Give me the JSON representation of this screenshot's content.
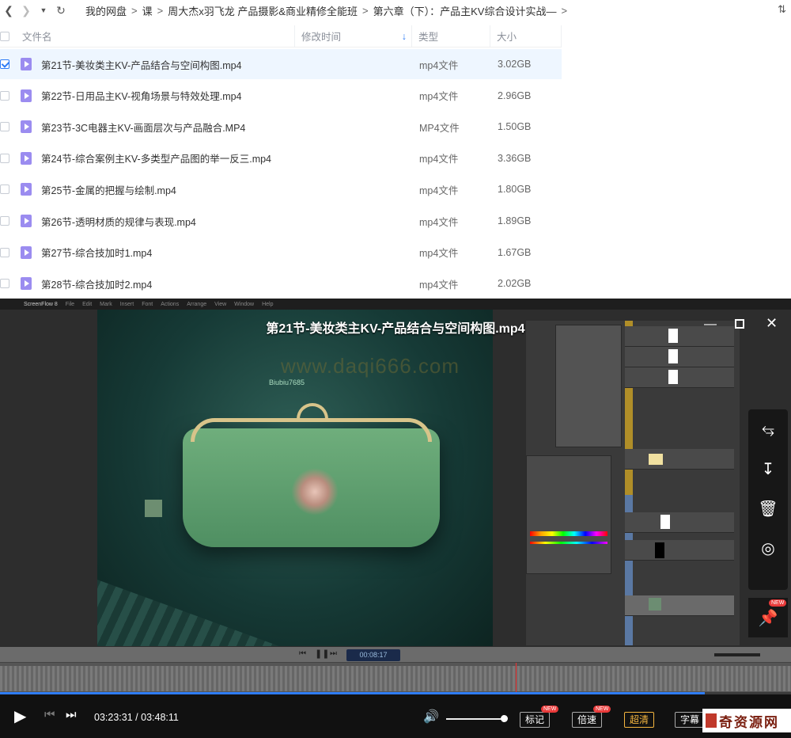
{
  "breadcrumb": [
    "我的网盘",
    "课",
    "周大杰x羽飞龙 产品摄影&商业精修全能班",
    "第六章（下）：产品主KV综合设计实战—"
  ],
  "columns": {
    "name": "文件名",
    "modified": "修改时间",
    "type": "类型",
    "size": "大小"
  },
  "files": [
    {
      "name": "第21节-美妆类主KV-产品结合与空间构图.mp4",
      "type": "mp4文件",
      "size": "3.02GB",
      "selected": true
    },
    {
      "name": "第22节-日用品主KV-视角场景与特效处理.mp4",
      "type": "mp4文件",
      "size": "2.96GB",
      "selected": false
    },
    {
      "name": "第23节-3C电器主KV-画面层次与产品融合.MP4",
      "type": "MP4文件",
      "size": "1.50GB",
      "selected": false
    },
    {
      "name": "第24节-综合案例主KV-多类型产品图的举一反三.mp4",
      "type": "mp4文件",
      "size": "3.36GB",
      "selected": false
    },
    {
      "name": "第25节-金属的把握与绘制.mp4",
      "type": "mp4文件",
      "size": "1.80GB",
      "selected": false
    },
    {
      "name": "第26节-透明材质的规律与表现.mp4",
      "type": "mp4文件",
      "size": "1.89GB",
      "selected": false
    },
    {
      "name": "第27节-综合技加时1.mp4",
      "type": "mp4文件",
      "size": "1.67GB",
      "selected": false
    },
    {
      "name": "第28节-综合技加时2.mp4",
      "type": "mp4文件",
      "size": "2.02GB",
      "selected": false
    }
  ],
  "player": {
    "title": "第21节-美妆类主KV-产品结合与空间构图.mp4",
    "watermark": "www.daqi666.com",
    "canvas_label": "Biubiu7685",
    "app_name": "ScreenFlow 8",
    "menu": [
      "File",
      "Edit",
      "Mark",
      "Insert",
      "Font",
      "Actions",
      "Arrange",
      "View",
      "Window",
      "Help"
    ],
    "timecode": "00:08:17",
    "current_time": "03:23:31",
    "duration": "03:48:11",
    "time_sep": "/",
    "progress": 0.891,
    "volume": 1.0,
    "buttons": {
      "mark": "标记",
      "speed": "倍速",
      "quality": "超清",
      "subtitle": "字幕"
    },
    "new_badge": "NEW"
  },
  "logo_text": "奇资源网",
  "logo_url": "www.daqi666.com",
  "colors": {
    "accent": "#2f7cf6",
    "file_icon": "#9b8cf0",
    "selected_row": "#eef6ff",
    "badge": "#e93a3a"
  }
}
